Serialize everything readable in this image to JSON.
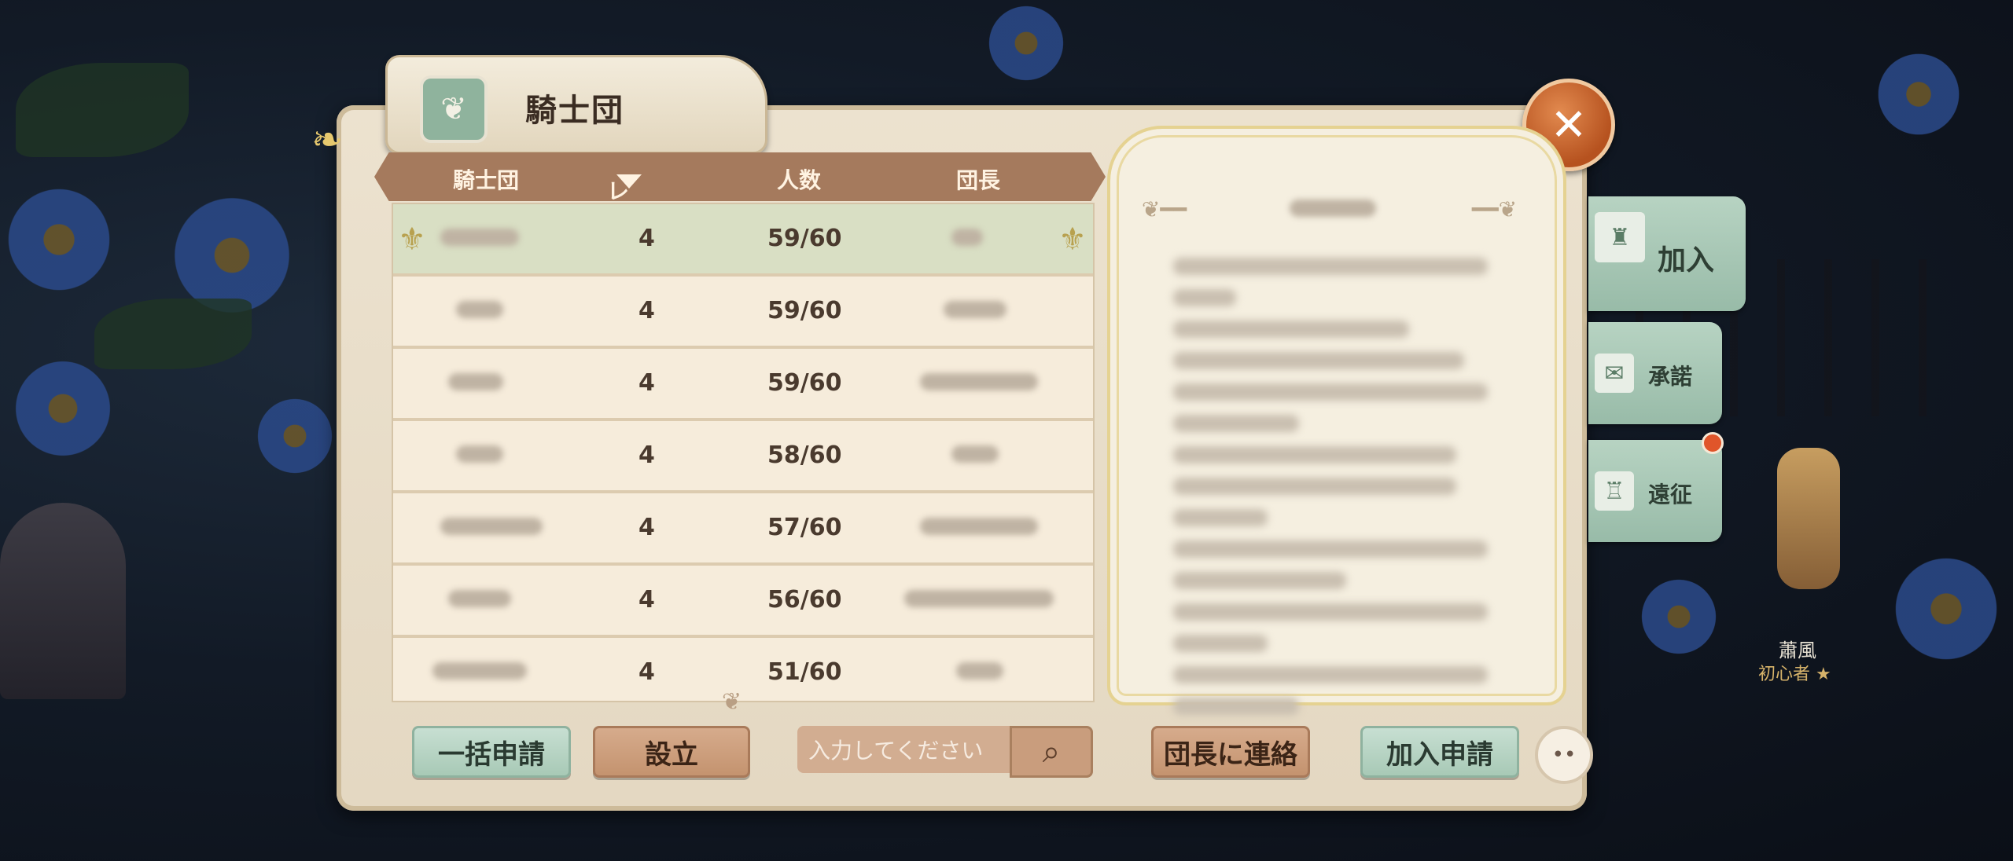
{
  "header": {
    "title": "騎士団",
    "emblem_icon": "fleur-icon"
  },
  "columns": {
    "name": "騎士団",
    "level": "レベル",
    "members": "人数",
    "leader": "団長"
  },
  "rows": [
    {
      "level": "4",
      "members": "59/60",
      "selected": true
    },
    {
      "level": "4",
      "members": "59/60",
      "selected": false
    },
    {
      "level": "4",
      "members": "59/60",
      "selected": false
    },
    {
      "level": "4",
      "members": "58/60",
      "selected": false
    },
    {
      "level": "4",
      "members": "57/60",
      "selected": false
    },
    {
      "level": "4",
      "members": "56/60",
      "selected": false
    },
    {
      "level": "4",
      "members": "51/60",
      "selected": false
    }
  ],
  "side_tabs": {
    "join": "加入",
    "approve": "承諾",
    "expedition": "遠征"
  },
  "buttons": {
    "bulk_apply": "一括申請",
    "establish": "設立",
    "contact_leader": "団長に連絡",
    "apply_join": "加入申請"
  },
  "search": {
    "placeholder": "入力してください"
  },
  "npc": {
    "name": "蕭風",
    "title": "初心者"
  },
  "colors": {
    "accent_green": "#a8c9b6",
    "accent_brown": "#c4936f",
    "close_orange": "#b6521f"
  }
}
